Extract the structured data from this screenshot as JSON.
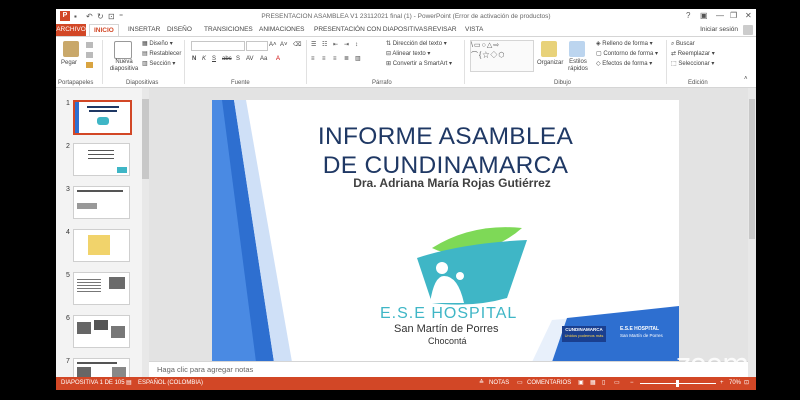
{
  "window": {
    "title": "PRESENTACION ASAMBLEA V1 23112021 final (1) - PowerPoint (Error de activación de productos)",
    "app_icon": "P",
    "controls": [
      "?",
      "▣",
      "—",
      "❐",
      "✕"
    ]
  },
  "tabs": [
    {
      "label": "ARCHIVO"
    },
    {
      "label": "INICIO"
    },
    {
      "label": "INSERTAR"
    },
    {
      "label": "DISEÑO"
    },
    {
      "label": "TRANSICIONES"
    },
    {
      "label": "ANIMACIONES"
    },
    {
      "label": "PRESENTACIÓN CON DIAPOSITIVAS"
    },
    {
      "label": "REVISAR"
    },
    {
      "label": "VISTA"
    }
  ],
  "signin": "Iniciar sesión",
  "ribbon": {
    "groups": {
      "portapapeles": "Portapapeles",
      "diapositivas": "Diapositivas",
      "fuente": "Fuente",
      "parrafo": "Párrafo",
      "dibujo": "Dibujo",
      "edicion": "Edición"
    },
    "pegar": "Pegar",
    "nueva_diapositiva": "Nueva diapositiva",
    "diseno": "Diseño",
    "restablecer": "Restablecer",
    "seccion": "Sección",
    "font_buttons": [
      "N",
      "K",
      "S",
      "abc",
      "S",
      "AV",
      "Aa",
      "A"
    ],
    "direccion_texto": "Dirección del texto",
    "alinear_texto": "Alinear texto",
    "convertir_smartart": "Convertir a SmartArt",
    "organizar": "Organizar",
    "estilos_rapidos": "Estilos rápidos",
    "relleno_forma": "Relleno de forma",
    "contorno_forma": "Contorno de forma",
    "efectos_forma": "Efectos de forma",
    "buscar": "Buscar",
    "reemplazar": "Reemplazar",
    "seleccionar": "Seleccionar"
  },
  "thumbnails": [
    {
      "num": "1"
    },
    {
      "num": "2"
    },
    {
      "num": "3"
    },
    {
      "num": "4"
    },
    {
      "num": "5"
    },
    {
      "num": "6"
    },
    {
      "num": "7"
    }
  ],
  "slide": {
    "title_line1": "INFORME ASAMBLEA",
    "title_line2": "DE CUNDINAMARCA",
    "subtitle": "Dra. Adriana María Rojas Gutiérrez",
    "logo_name": "E.S.E HOSPITAL",
    "logo_sub1": "San Martín de Porres",
    "logo_sub2": "Chocontá",
    "badge_hospital": "E.S.E HOSPITAL",
    "badge_name": "San Martín de Porres",
    "badge_cundi": "CUNDINAMARCA",
    "badge_cundi_sub": "Unidos podemos más"
  },
  "notes": {
    "placeholder": "Haga clic para agregar notas"
  },
  "status": {
    "slide_counter": "DIAPOSITIVA 1 DE 105",
    "language": "ESPAÑOL (COLOMBIA)",
    "notas": "NOTAS",
    "comentarios": "COMENTARIOS",
    "zoom_level": "70%",
    "zoom_minus": "−",
    "zoom_plus": "+"
  },
  "watermark": "zoom",
  "colors": {
    "accent": "#d24726",
    "slide_title": "#1f3864",
    "logo_teal": "#3fb6c6",
    "logo_green": "#7ed957",
    "slide_blue": "#2e6fd0"
  }
}
